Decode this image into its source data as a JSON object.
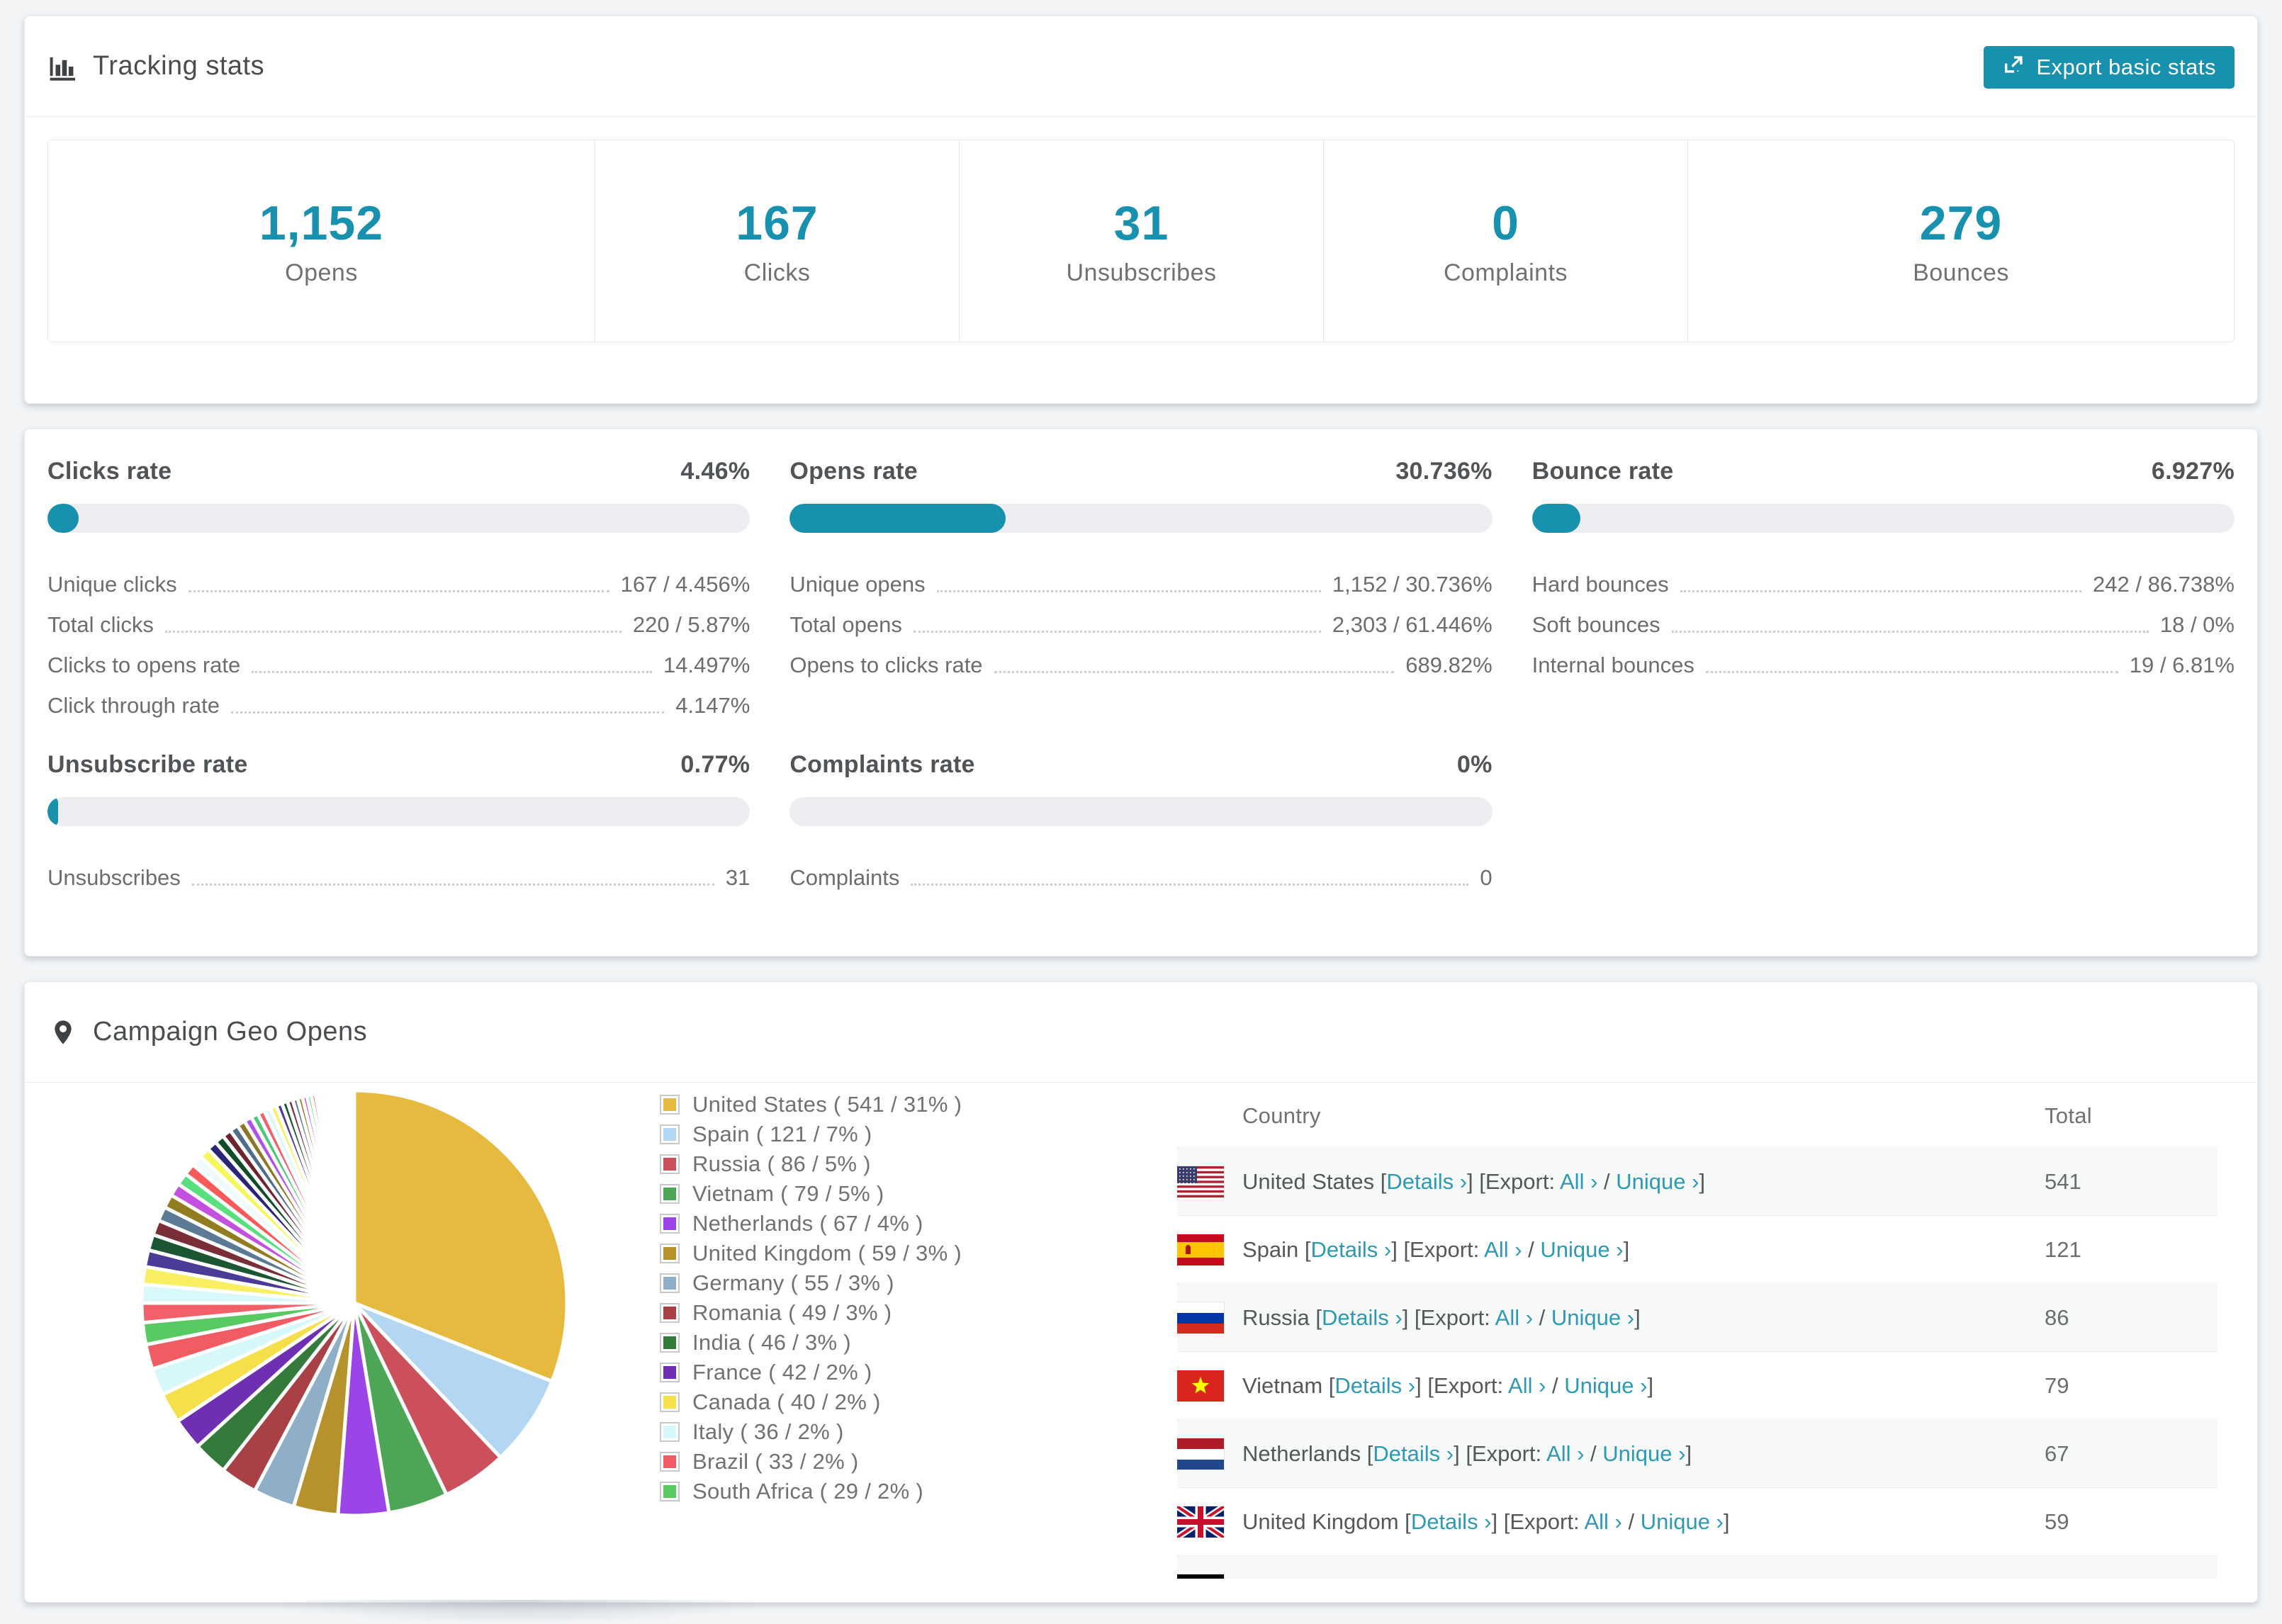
{
  "colors": {
    "accent": "#1791ad",
    "link": "#2d99b3",
    "page_background": "#f2f4f6",
    "card_background": "#ffffff"
  },
  "tracking": {
    "title": "Tracking stats",
    "export_label": "Export basic stats",
    "summary": [
      {
        "value": "1,152",
        "label": "Opens"
      },
      {
        "value": "167",
        "label": "Clicks"
      },
      {
        "value": "31",
        "label": "Unsubscribes"
      },
      {
        "value": "0",
        "label": "Complaints"
      },
      {
        "value": "279",
        "label": "Bounces"
      }
    ]
  },
  "rates": {
    "blocks": [
      {
        "title": "Clicks rate",
        "value": "4.46%",
        "percent": 4.46,
        "rows": [
          [
            "Unique clicks",
            "167 / 4.456%"
          ],
          [
            "Total clicks",
            "220 / 5.87%"
          ],
          [
            "Clicks to opens rate",
            "14.497%"
          ],
          [
            "Click through rate",
            "4.147%"
          ]
        ]
      },
      {
        "title": "Opens rate",
        "value": "30.736%",
        "percent": 30.736,
        "rows": [
          [
            "Unique opens",
            "1,152 / 30.736%"
          ],
          [
            "Total opens",
            "2,303 / 61.446%"
          ],
          [
            "Opens to clicks rate",
            "689.82%"
          ]
        ]
      },
      {
        "title": "Bounce rate",
        "value": "6.927%",
        "percent": 6.927,
        "rows": [
          [
            "Hard bounces",
            "242 / 86.738%"
          ],
          [
            "Soft bounces",
            "18 / 0%"
          ],
          [
            "Internal bounces",
            "19 / 6.81%"
          ]
        ]
      },
      {
        "title": "Unsubscribe rate",
        "value": "0.77%",
        "percent": 0.77,
        "rows": [
          [
            "Unsubscribes",
            "31"
          ]
        ]
      },
      {
        "title": "Complaints rate",
        "value": "0%",
        "percent": 0,
        "rows": [
          [
            "Complaints",
            "0"
          ]
        ]
      }
    ]
  },
  "geo": {
    "title": "Campaign Geo Opens",
    "chart_data": {
      "type": "pie",
      "title": "Campaign Geo Opens",
      "start_angle_deg": -90,
      "direction": "clockwise",
      "legend_position": "right",
      "label_format": "name ( count / pct% )",
      "series": [
        {
          "name": "United States",
          "count": 541,
          "pct": 31,
          "color": "#e6b93f"
        },
        {
          "name": "Spain",
          "count": 121,
          "pct": 7,
          "color": "#b3d7f2"
        },
        {
          "name": "Russia",
          "count": 86,
          "pct": 5,
          "color": "#cc505c"
        },
        {
          "name": "Vietnam",
          "count": 79,
          "pct": 5,
          "color": "#4ca656"
        },
        {
          "name": "Netherlands",
          "count": 67,
          "pct": 4,
          "color": "#9b44e8"
        },
        {
          "name": "United Kingdom",
          "count": 59,
          "pct": 3,
          "color": "#b5922c"
        },
        {
          "name": "Germany",
          "count": 55,
          "pct": 3,
          "color": "#8fafc8"
        },
        {
          "name": "Romania",
          "count": 49,
          "pct": 3,
          "color": "#a84046"
        },
        {
          "name": "India",
          "count": 46,
          "pct": 3,
          "color": "#337a3b"
        },
        {
          "name": "France",
          "count": 42,
          "pct": 2,
          "color": "#6f2fb3"
        },
        {
          "name": "Canada",
          "count": 40,
          "pct": 2,
          "color": "#f5e04b"
        },
        {
          "name": "Italy",
          "count": 36,
          "pct": 2,
          "color": "#d6f8fb"
        },
        {
          "name": "Brazil",
          "count": 33,
          "pct": 2,
          "color": "#f15b62"
        },
        {
          "name": "South Africa",
          "count": 29,
          "pct": 2,
          "color": "#58c963"
        }
      ],
      "others": {
        "total_count": 462,
        "slice_count": 44,
        "decay": 0.95,
        "palette": [
          "#f2606a",
          "#d8f8fb",
          "#f8f060",
          "#4b3a96",
          "#1b5632",
          "#7a2e38",
          "#5a7a96",
          "#927c20",
          "#c44fe0",
          "#58e07e",
          "#fa5a5a",
          "#eefbfd",
          "#f6f65e",
          "#2a2478",
          "#0f4d28",
          "#6e2430",
          "#4e6e8c",
          "#8a7828",
          "#b050e8",
          "#50c878"
        ]
      }
    },
    "table": {
      "headers": [
        "Country",
        "Total"
      ],
      "link_text": {
        "details": "Details",
        "all": "All",
        "unique": "Unique",
        "export": "Export:",
        "chev": "›"
      },
      "rows": [
        {
          "country": "United States",
          "flag": "us",
          "total": "541"
        },
        {
          "country": "Spain",
          "flag": "es",
          "total": "121"
        },
        {
          "country": "Russia",
          "flag": "ru",
          "total": "86"
        },
        {
          "country": "Vietnam",
          "flag": "vn",
          "total": "79"
        },
        {
          "country": "Netherlands",
          "flag": "nl",
          "total": "67"
        },
        {
          "country": "United Kingdom",
          "flag": "gb",
          "total": "59"
        },
        {
          "flag": "de",
          "partial": true
        }
      ]
    }
  }
}
